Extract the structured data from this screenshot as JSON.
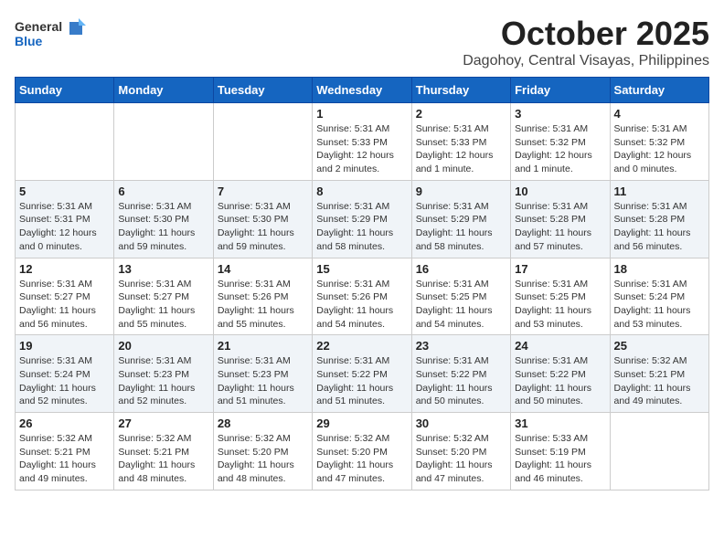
{
  "header": {
    "logo_general": "General",
    "logo_blue": "Blue",
    "month_year": "October 2025",
    "location": "Dagohoy, Central Visayas, Philippines"
  },
  "weekdays": [
    "Sunday",
    "Monday",
    "Tuesday",
    "Wednesday",
    "Thursday",
    "Friday",
    "Saturday"
  ],
  "weeks": [
    [
      {
        "day": "",
        "info": ""
      },
      {
        "day": "",
        "info": ""
      },
      {
        "day": "",
        "info": ""
      },
      {
        "day": "1",
        "info": "Sunrise: 5:31 AM\nSunset: 5:33 PM\nDaylight: 12 hours\nand 2 minutes."
      },
      {
        "day": "2",
        "info": "Sunrise: 5:31 AM\nSunset: 5:33 PM\nDaylight: 12 hours\nand 1 minute."
      },
      {
        "day": "3",
        "info": "Sunrise: 5:31 AM\nSunset: 5:32 PM\nDaylight: 12 hours\nand 1 minute."
      },
      {
        "day": "4",
        "info": "Sunrise: 5:31 AM\nSunset: 5:32 PM\nDaylight: 12 hours\nand 0 minutes."
      }
    ],
    [
      {
        "day": "5",
        "info": "Sunrise: 5:31 AM\nSunset: 5:31 PM\nDaylight: 12 hours\nand 0 minutes."
      },
      {
        "day": "6",
        "info": "Sunrise: 5:31 AM\nSunset: 5:30 PM\nDaylight: 11 hours\nand 59 minutes."
      },
      {
        "day": "7",
        "info": "Sunrise: 5:31 AM\nSunset: 5:30 PM\nDaylight: 11 hours\nand 59 minutes."
      },
      {
        "day": "8",
        "info": "Sunrise: 5:31 AM\nSunset: 5:29 PM\nDaylight: 11 hours\nand 58 minutes."
      },
      {
        "day": "9",
        "info": "Sunrise: 5:31 AM\nSunset: 5:29 PM\nDaylight: 11 hours\nand 58 minutes."
      },
      {
        "day": "10",
        "info": "Sunrise: 5:31 AM\nSunset: 5:28 PM\nDaylight: 11 hours\nand 57 minutes."
      },
      {
        "day": "11",
        "info": "Sunrise: 5:31 AM\nSunset: 5:28 PM\nDaylight: 11 hours\nand 56 minutes."
      }
    ],
    [
      {
        "day": "12",
        "info": "Sunrise: 5:31 AM\nSunset: 5:27 PM\nDaylight: 11 hours\nand 56 minutes."
      },
      {
        "day": "13",
        "info": "Sunrise: 5:31 AM\nSunset: 5:27 PM\nDaylight: 11 hours\nand 55 minutes."
      },
      {
        "day": "14",
        "info": "Sunrise: 5:31 AM\nSunset: 5:26 PM\nDaylight: 11 hours\nand 55 minutes."
      },
      {
        "day": "15",
        "info": "Sunrise: 5:31 AM\nSunset: 5:26 PM\nDaylight: 11 hours\nand 54 minutes."
      },
      {
        "day": "16",
        "info": "Sunrise: 5:31 AM\nSunset: 5:25 PM\nDaylight: 11 hours\nand 54 minutes."
      },
      {
        "day": "17",
        "info": "Sunrise: 5:31 AM\nSunset: 5:25 PM\nDaylight: 11 hours\nand 53 minutes."
      },
      {
        "day": "18",
        "info": "Sunrise: 5:31 AM\nSunset: 5:24 PM\nDaylight: 11 hours\nand 53 minutes."
      }
    ],
    [
      {
        "day": "19",
        "info": "Sunrise: 5:31 AM\nSunset: 5:24 PM\nDaylight: 11 hours\nand 52 minutes."
      },
      {
        "day": "20",
        "info": "Sunrise: 5:31 AM\nSunset: 5:23 PM\nDaylight: 11 hours\nand 52 minutes."
      },
      {
        "day": "21",
        "info": "Sunrise: 5:31 AM\nSunset: 5:23 PM\nDaylight: 11 hours\nand 51 minutes."
      },
      {
        "day": "22",
        "info": "Sunrise: 5:31 AM\nSunset: 5:22 PM\nDaylight: 11 hours\nand 51 minutes."
      },
      {
        "day": "23",
        "info": "Sunrise: 5:31 AM\nSunset: 5:22 PM\nDaylight: 11 hours\nand 50 minutes."
      },
      {
        "day": "24",
        "info": "Sunrise: 5:31 AM\nSunset: 5:22 PM\nDaylight: 11 hours\nand 50 minutes."
      },
      {
        "day": "25",
        "info": "Sunrise: 5:32 AM\nSunset: 5:21 PM\nDaylight: 11 hours\nand 49 minutes."
      }
    ],
    [
      {
        "day": "26",
        "info": "Sunrise: 5:32 AM\nSunset: 5:21 PM\nDaylight: 11 hours\nand 49 minutes."
      },
      {
        "day": "27",
        "info": "Sunrise: 5:32 AM\nSunset: 5:21 PM\nDaylight: 11 hours\nand 48 minutes."
      },
      {
        "day": "28",
        "info": "Sunrise: 5:32 AM\nSunset: 5:20 PM\nDaylight: 11 hours\nand 48 minutes."
      },
      {
        "day": "29",
        "info": "Sunrise: 5:32 AM\nSunset: 5:20 PM\nDaylight: 11 hours\nand 47 minutes."
      },
      {
        "day": "30",
        "info": "Sunrise: 5:32 AM\nSunset: 5:20 PM\nDaylight: 11 hours\nand 47 minutes."
      },
      {
        "day": "31",
        "info": "Sunrise: 5:33 AM\nSunset: 5:19 PM\nDaylight: 11 hours\nand 46 minutes."
      },
      {
        "day": "",
        "info": ""
      }
    ]
  ]
}
